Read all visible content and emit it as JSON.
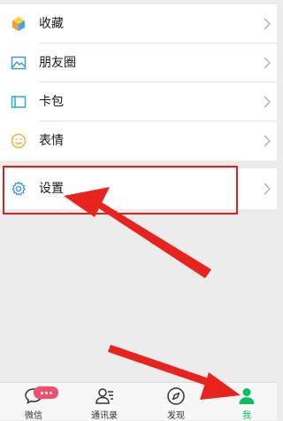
{
  "menu": {
    "items": [
      {
        "label": "收藏",
        "icon": "cube-icon"
      },
      {
        "label": "朋友圈",
        "icon": "photo-icon"
      },
      {
        "label": "卡包",
        "icon": "card-icon"
      },
      {
        "label": "表情",
        "icon": "smiley-icon"
      },
      {
        "label": "设置",
        "icon": "gear-icon"
      }
    ]
  },
  "tabbar": {
    "tabs": [
      {
        "label": "微信",
        "icon": "chat-icon",
        "active": false
      },
      {
        "label": "通讯录",
        "icon": "contacts-icon",
        "active": false
      },
      {
        "label": "发现",
        "icon": "compass-icon",
        "active": false
      },
      {
        "label": "我",
        "icon": "person-icon",
        "active": true
      }
    ]
  },
  "colors": {
    "accent": "#07c160",
    "highlight": "#e02020",
    "badge": "#f0506e"
  }
}
